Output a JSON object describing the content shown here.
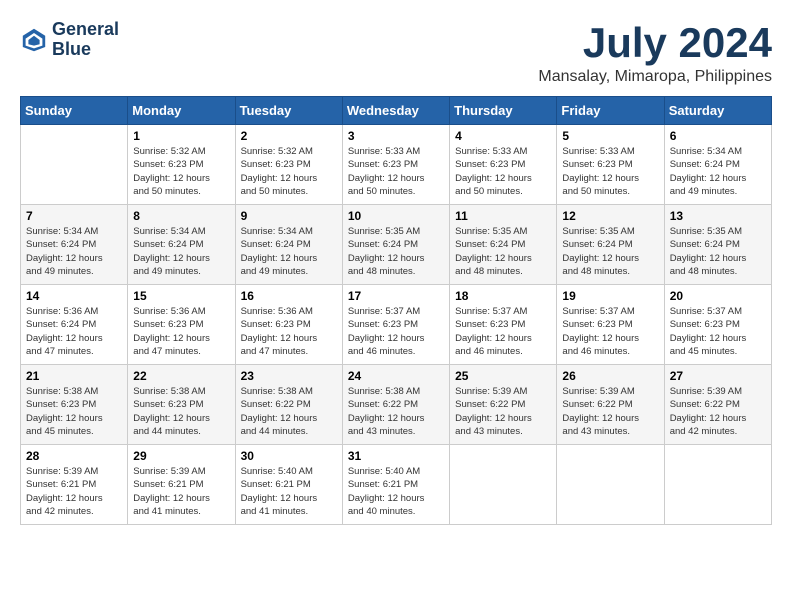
{
  "logo": {
    "line1": "General",
    "line2": "Blue"
  },
  "title": {
    "month_year": "July 2024",
    "location": "Mansalay, Mimaropa, Philippines"
  },
  "weekdays": [
    "Sunday",
    "Monday",
    "Tuesday",
    "Wednesday",
    "Thursday",
    "Friday",
    "Saturday"
  ],
  "weeks": [
    [
      {
        "day": "",
        "info": ""
      },
      {
        "day": "1",
        "info": "Sunrise: 5:32 AM\nSunset: 6:23 PM\nDaylight: 12 hours\nand 50 minutes."
      },
      {
        "day": "2",
        "info": "Sunrise: 5:32 AM\nSunset: 6:23 PM\nDaylight: 12 hours\nand 50 minutes."
      },
      {
        "day": "3",
        "info": "Sunrise: 5:33 AM\nSunset: 6:23 PM\nDaylight: 12 hours\nand 50 minutes."
      },
      {
        "day": "4",
        "info": "Sunrise: 5:33 AM\nSunset: 6:23 PM\nDaylight: 12 hours\nand 50 minutes."
      },
      {
        "day": "5",
        "info": "Sunrise: 5:33 AM\nSunset: 6:23 PM\nDaylight: 12 hours\nand 50 minutes."
      },
      {
        "day": "6",
        "info": "Sunrise: 5:34 AM\nSunset: 6:24 PM\nDaylight: 12 hours\nand 49 minutes."
      }
    ],
    [
      {
        "day": "7",
        "info": "Sunrise: 5:34 AM\nSunset: 6:24 PM\nDaylight: 12 hours\nand 49 minutes."
      },
      {
        "day": "8",
        "info": "Sunrise: 5:34 AM\nSunset: 6:24 PM\nDaylight: 12 hours\nand 49 minutes."
      },
      {
        "day": "9",
        "info": "Sunrise: 5:34 AM\nSunset: 6:24 PM\nDaylight: 12 hours\nand 49 minutes."
      },
      {
        "day": "10",
        "info": "Sunrise: 5:35 AM\nSunset: 6:24 PM\nDaylight: 12 hours\nand 48 minutes."
      },
      {
        "day": "11",
        "info": "Sunrise: 5:35 AM\nSunset: 6:24 PM\nDaylight: 12 hours\nand 48 minutes."
      },
      {
        "day": "12",
        "info": "Sunrise: 5:35 AM\nSunset: 6:24 PM\nDaylight: 12 hours\nand 48 minutes."
      },
      {
        "day": "13",
        "info": "Sunrise: 5:35 AM\nSunset: 6:24 PM\nDaylight: 12 hours\nand 48 minutes."
      }
    ],
    [
      {
        "day": "14",
        "info": "Sunrise: 5:36 AM\nSunset: 6:24 PM\nDaylight: 12 hours\nand 47 minutes."
      },
      {
        "day": "15",
        "info": "Sunrise: 5:36 AM\nSunset: 6:23 PM\nDaylight: 12 hours\nand 47 minutes."
      },
      {
        "day": "16",
        "info": "Sunrise: 5:36 AM\nSunset: 6:23 PM\nDaylight: 12 hours\nand 47 minutes."
      },
      {
        "day": "17",
        "info": "Sunrise: 5:37 AM\nSunset: 6:23 PM\nDaylight: 12 hours\nand 46 minutes."
      },
      {
        "day": "18",
        "info": "Sunrise: 5:37 AM\nSunset: 6:23 PM\nDaylight: 12 hours\nand 46 minutes."
      },
      {
        "day": "19",
        "info": "Sunrise: 5:37 AM\nSunset: 6:23 PM\nDaylight: 12 hours\nand 46 minutes."
      },
      {
        "day": "20",
        "info": "Sunrise: 5:37 AM\nSunset: 6:23 PM\nDaylight: 12 hours\nand 45 minutes."
      }
    ],
    [
      {
        "day": "21",
        "info": "Sunrise: 5:38 AM\nSunset: 6:23 PM\nDaylight: 12 hours\nand 45 minutes."
      },
      {
        "day": "22",
        "info": "Sunrise: 5:38 AM\nSunset: 6:23 PM\nDaylight: 12 hours\nand 44 minutes."
      },
      {
        "day": "23",
        "info": "Sunrise: 5:38 AM\nSunset: 6:22 PM\nDaylight: 12 hours\nand 44 minutes."
      },
      {
        "day": "24",
        "info": "Sunrise: 5:38 AM\nSunset: 6:22 PM\nDaylight: 12 hours\nand 43 minutes."
      },
      {
        "day": "25",
        "info": "Sunrise: 5:39 AM\nSunset: 6:22 PM\nDaylight: 12 hours\nand 43 minutes."
      },
      {
        "day": "26",
        "info": "Sunrise: 5:39 AM\nSunset: 6:22 PM\nDaylight: 12 hours\nand 43 minutes."
      },
      {
        "day": "27",
        "info": "Sunrise: 5:39 AM\nSunset: 6:22 PM\nDaylight: 12 hours\nand 42 minutes."
      }
    ],
    [
      {
        "day": "28",
        "info": "Sunrise: 5:39 AM\nSunset: 6:21 PM\nDaylight: 12 hours\nand 42 minutes."
      },
      {
        "day": "29",
        "info": "Sunrise: 5:39 AM\nSunset: 6:21 PM\nDaylight: 12 hours\nand 41 minutes."
      },
      {
        "day": "30",
        "info": "Sunrise: 5:40 AM\nSunset: 6:21 PM\nDaylight: 12 hours\nand 41 minutes."
      },
      {
        "day": "31",
        "info": "Sunrise: 5:40 AM\nSunset: 6:21 PM\nDaylight: 12 hours\nand 40 minutes."
      },
      {
        "day": "",
        "info": ""
      },
      {
        "day": "",
        "info": ""
      },
      {
        "day": "",
        "info": ""
      }
    ]
  ]
}
